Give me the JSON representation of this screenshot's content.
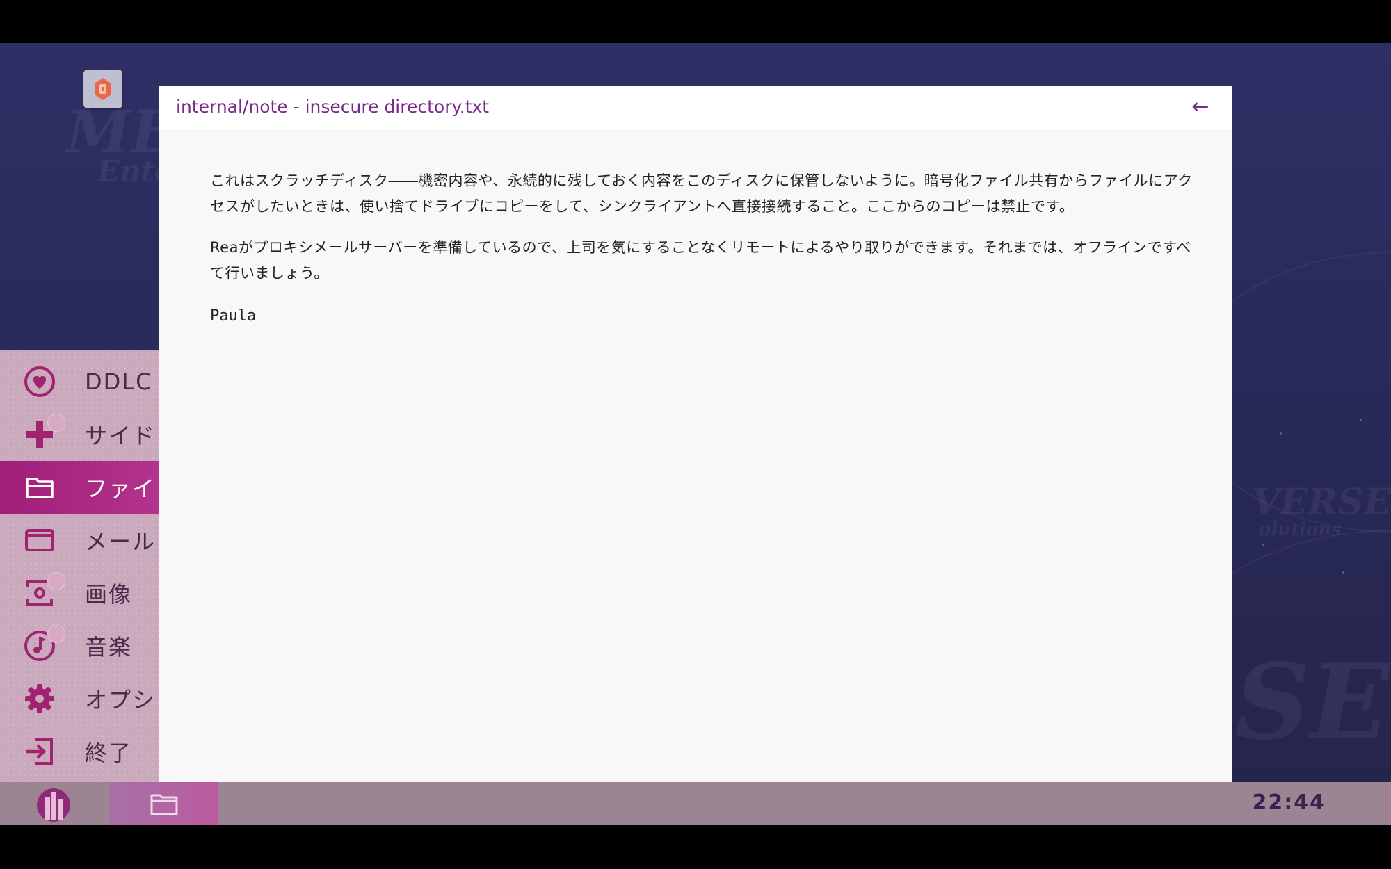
{
  "window": {
    "title": "internal/note - insecure directory.txt",
    "back_icon": "←"
  },
  "document": {
    "paragraphs": [
      "これはスクラッチディスク――機密内容や、永続的に残しておく内容をこのディスクに保管しないように。暗号化ファイル共有からファイルにアクセスがしたいときは、使い捨てドライブにコピーをして、シンクライアントへ直接接続すること。ここからのコピーは禁止です。",
      "Reaがプロキシメールサーバーを準備しているので、上司を気にすることなくリモートによるやり取りができます。それまでは、オフラインですべて行いましょう。"
    ],
    "signature": "Paula"
  },
  "start_menu": {
    "items": [
      {
        "label": "DDLC",
        "icon": "heart-icon",
        "active": false,
        "badge": false
      },
      {
        "label": "サイド",
        "icon": "plus-icon",
        "active": false,
        "badge": true
      },
      {
        "label": "ファイ",
        "icon": "folder-icon",
        "active": true,
        "badge": false
      },
      {
        "label": "メール",
        "icon": "mail-icon",
        "active": false,
        "badge": false
      },
      {
        "label": "画像",
        "icon": "camera-icon",
        "active": false,
        "badge": true
      },
      {
        "label": "音楽",
        "icon": "music-icon",
        "active": false,
        "badge": true
      },
      {
        "label": "オプシ",
        "icon": "gear-icon",
        "active": false,
        "badge": false
      },
      {
        "label": "終了",
        "icon": "exit-icon",
        "active": false,
        "badge": false
      }
    ]
  },
  "taskbar": {
    "clock": "22:44",
    "logo_icon": "building-logo-icon",
    "window_icon": "window-icon"
  },
  "colors": {
    "accent": "#a01e78",
    "title_text": "#7a2a8a",
    "menu_bg": "#c9a9bb",
    "taskbar_bg": "#9d8492",
    "desktop_bg": "#2a2a5c"
  }
}
